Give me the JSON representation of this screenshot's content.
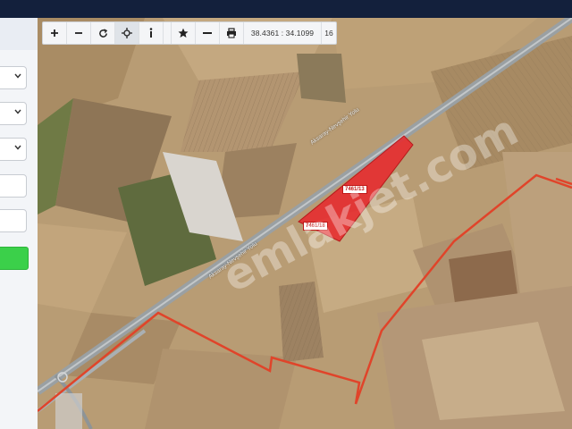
{
  "toolbar": {
    "buttons": [
      {
        "name": "zoom-in-button",
        "icon": "plus-icon",
        "glyph": "+"
      },
      {
        "name": "zoom-out-button",
        "icon": "minus-icon",
        "glyph": "−"
      },
      {
        "name": "refresh-button",
        "icon": "refresh-icon",
        "glyph": "↻"
      },
      {
        "name": "locate-button",
        "icon": "crosshair-icon",
        "glyph": "⌖"
      },
      {
        "name": "info-button",
        "icon": "info-icon",
        "glyph": "i"
      },
      {
        "name": "favorite-button",
        "icon": "star-icon",
        "glyph": "★"
      },
      {
        "name": "measure-button",
        "icon": "ruler-line-icon",
        "glyph": "—"
      },
      {
        "name": "print-button",
        "icon": "printer-icon",
        "glyph": "⎙"
      }
    ],
    "coordinates": "38.4361 : 34.1099",
    "zoom_level": "16"
  },
  "map": {
    "road_label_upper": "Aksaray-Nevşehir Yolu",
    "road_label_lower": "Aksaray-Nevşehir Yolu",
    "parcel_label_1": "7461/13",
    "parcel_label_2": "7461/18",
    "watermark": "emlakjet.com",
    "colors": {
      "parcel_fill": "#e8262b",
      "boundary": "#e0442a",
      "road": "#9aa0a3"
    }
  },
  "sidebar": {
    "dropdowns": 3,
    "inputs": 2,
    "action_button_color": "#3bd04a"
  }
}
